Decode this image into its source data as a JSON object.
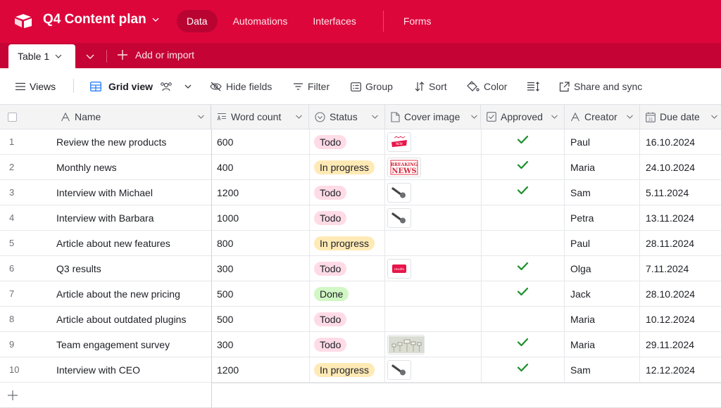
{
  "app": {
    "base_name": "Q4 Content plan",
    "nav": [
      {
        "label": "Data",
        "active": true
      },
      {
        "label": "Automations",
        "active": false
      },
      {
        "label": "Interfaces",
        "active": false
      },
      {
        "label": "Forms",
        "active": false
      }
    ]
  },
  "tabs": {
    "active_table": "Table 1",
    "add_import_label": "Add or import"
  },
  "toolbar": {
    "views_label": "Views",
    "view_name": "Grid view",
    "hide_fields_label": "Hide fields",
    "filter_label": "Filter",
    "group_label": "Group",
    "sort_label": "Sort",
    "color_label": "Color",
    "share_label": "Share and sync"
  },
  "columns": [
    {
      "label": "Name",
      "icon": "text-icon"
    },
    {
      "label": "Word count",
      "icon": "long-text-icon"
    },
    {
      "label": "Status",
      "icon": "single-select-icon"
    },
    {
      "label": "Cover image",
      "icon": "attachment-icon"
    },
    {
      "label": "Approved",
      "icon": "checkbox-icon"
    },
    {
      "label": "Creator",
      "icon": "text-icon"
    },
    {
      "label": "Due date",
      "icon": "calendar-icon"
    }
  ],
  "status_colors": {
    "Todo": "#ffdbe6",
    "In progress": "#ffeab6",
    "Done": "#d1f7c4"
  },
  "accent_color": "#dd063b",
  "check_color": "#1a8f2a",
  "rows": [
    {
      "num": "1",
      "name": "Review the new products",
      "word_count": "600",
      "status": "Todo",
      "cover": "new-products-badge",
      "approved": true,
      "creator": "Paul",
      "due": "16.10.2024"
    },
    {
      "num": "2",
      "name": "Monthly news",
      "word_count": "400",
      "status": "In progress",
      "cover": "breaking-news",
      "approved": true,
      "creator": "Maria",
      "due": "24.10.2024"
    },
    {
      "num": "3",
      "name": "Interview with Michael",
      "word_count": "1200",
      "status": "Todo",
      "cover": "microphone",
      "approved": true,
      "creator": "Sam",
      "due": "5.11.2024"
    },
    {
      "num": "4",
      "name": "Interview with Barbara",
      "word_count": "1000",
      "status": "Todo",
      "cover": "microphone",
      "approved": false,
      "creator": "Petra",
      "due": "13.11.2024"
    },
    {
      "num": "5",
      "name": "Article about new features",
      "word_count": "800",
      "status": "In progress",
      "cover": "",
      "approved": false,
      "creator": "Paul",
      "due": "28.11.2024"
    },
    {
      "num": "6",
      "name": "Q3 results",
      "word_count": "300",
      "status": "Todo",
      "cover": "results-badge",
      "approved": true,
      "creator": "Olga",
      "due": "7.11.2024"
    },
    {
      "num": "7",
      "name": "Article about the new pricing",
      "word_count": "500",
      "status": "Done",
      "cover": "",
      "approved": true,
      "creator": "Jack",
      "due": "28.10.2024"
    },
    {
      "num": "8",
      "name": "Article about outdated plugins",
      "word_count": "500",
      "status": "Todo",
      "cover": "",
      "approved": false,
      "creator": "Maria",
      "due": "10.12.2024"
    },
    {
      "num": "9",
      "name": "Team engagement survey",
      "word_count": "300",
      "status": "Todo",
      "cover": "survey-signs",
      "approved": true,
      "creator": "Maria",
      "due": "29.11.2024"
    },
    {
      "num": "10",
      "name": "Interview with CEO",
      "word_count": "1200",
      "status": "In progress",
      "cover": "microphone",
      "approved": true,
      "creator": "Sam",
      "due": "12.12.2024"
    }
  ]
}
